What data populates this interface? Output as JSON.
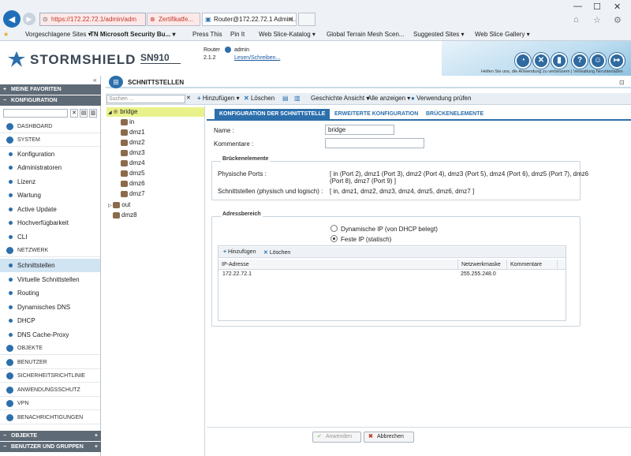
{
  "browser": {
    "address": "https://172.22.72.1/admin/adm",
    "tabs": [
      "Zertifikatfe...",
      "Router@172.22.72.1 Admini..."
    ],
    "favorites": [
      "Vorgeschlagene Sites ▾",
      "TN Microsoft Security Bu... ▾",
      "Press This",
      "Pin It",
      "Web Slice-Katalog ▾",
      "Global Terrain Mesh Scen...",
      "Suggested Sites ▾",
      "Web Slice Gallery ▾"
    ]
  },
  "header": {
    "brand": "STORMSHIELD",
    "model": "SN910",
    "router_label": "Router",
    "version": "2.1.2",
    "user": "admin",
    "access": "Lesen/Schreiben...",
    "help_text": "Helfen Sie uns, die Anwendung zu verbessern  |  Verwaltung herunterladen",
    "icons": [
      "dashboard-icon",
      "tools-icon",
      "monitor-icon",
      "help-icon",
      "user-icon",
      "logout-icon"
    ]
  },
  "sidebar": {
    "favorites": "MEINE FAVORITEN",
    "konfiguration": "KONFIGURATION",
    "dashboard": "DASHBOARD",
    "system": "SYSTEM",
    "system_items": [
      "Konfiguration",
      "Administratoren",
      "Lizenz",
      "Wartung",
      "Active Update",
      "Hochverfügbarkeit",
      "CLI"
    ],
    "netzwerk": "NETZWERK",
    "netzwerk_items": [
      "Schnittstellen",
      "Virtuelle Schnittstellen",
      "Routing",
      "Dynamisches DNS",
      "DHCP",
      "DNS Cache-Proxy"
    ],
    "sections": [
      "OBJEKTE",
      "BENUTZER",
      "SICHERHEITSRICHTLINIE",
      "ANWENDUNGSSCHUTZ",
      "VPN",
      "BENACHRICHTIGUNGEN"
    ],
    "bottom": [
      "OBJEKTE",
      "BENUTZER UND GRUPPEN"
    ]
  },
  "module": {
    "title": "SCHNITTSTELLEN",
    "search_placeholder": "Suchen ...",
    "toolbar": {
      "add": "Hinzufügen ▾",
      "delete": "Löschen",
      "view": "Geschichte Ansicht ▾",
      "show_all": "Alle anzeigen ▾",
      "usage": "Verwendung prüfen"
    }
  },
  "tree": {
    "bridge": "bridge",
    "children": [
      "in",
      "dmz1",
      "dmz2",
      "dmz3",
      "dmz4",
      "dmz5",
      "dmz6",
      "dmz7"
    ],
    "out": "out",
    "dmz8": "dmz8"
  },
  "tabs": [
    "KONFIGURATION DER SCHNITTSTELLE",
    "ERWEITERTE KONFIGURATION",
    "BRÜCKENELEMENTE"
  ],
  "form": {
    "name_label": "Name :",
    "name_value": "bridge",
    "comment_label": "Kommentare :",
    "comment_value": "",
    "bridge_title": "Brückenelemente",
    "physical_label": "Physische Ports :",
    "physical_value_1": "[ in (Port 2), dmz1 (Port 3), dmz2 (Port 4), dmz3 (Port 5), dmz4 (Port 6), dmz5 (Port 7), dmz6",
    "physical_value_2": "(Port 8), dmz7 (Port 9) ]",
    "interfaces_label": "Schnittstellen (physisch und logisch) :",
    "interfaces_value": "[ in, dmz1, dmz2, dmz3, dmz4, dmz5, dmz6, dmz7 ]",
    "address_title": "Adressbereich",
    "dhcp": "Dynamische IP (von DHCP belegt)",
    "static": "Feste IP (statisch)",
    "grid_add": "Hinzufügen",
    "grid_delete": "Löschen",
    "grid_headers": [
      "IP-Adresse",
      "Netzwerkmaske",
      "Kommentare"
    ],
    "grid_row": [
      "172.22.72.1",
      "255.255.248.0",
      ""
    ]
  },
  "buttons": {
    "apply": "Anwenden",
    "cancel": "Abbrechen"
  }
}
